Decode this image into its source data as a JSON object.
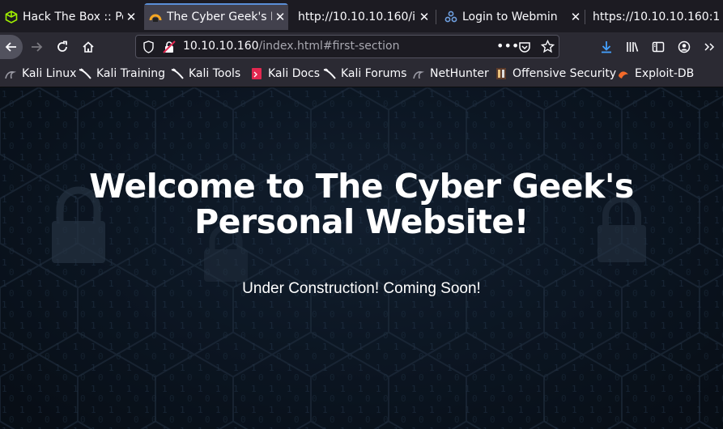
{
  "tabs": [
    {
      "label": "Hack The Box :: Po",
      "icon": "htb-cube-icon"
    },
    {
      "label": "The Cyber Geek's P",
      "icon": "cyber-geek-icon",
      "active": true
    },
    {
      "label": "http://10.10.10.160/in",
      "icon": ""
    },
    {
      "label": "Login to Webmin",
      "icon": "webmin-icon"
    },
    {
      "label": "https://10.10.10.160:1",
      "icon": ""
    }
  ],
  "urlbar": {
    "host": "10.10.10.160",
    "path": "/index.html#first-section"
  },
  "bookmarks": [
    {
      "label": "Kali Linux",
      "icon": "kali-dragon-icon"
    },
    {
      "label": "Kali Training",
      "icon": "kali-dragon-icon"
    },
    {
      "label": "Kali Tools",
      "icon": "kali-dragon-icon"
    },
    {
      "label": "Kali Docs",
      "icon": "kali-docs-icon"
    },
    {
      "label": "Kali Forums",
      "icon": "kali-dragon-icon"
    },
    {
      "label": "NetHunter",
      "icon": "nethunter-icon"
    },
    {
      "label": "Offensive Security",
      "icon": "offsec-icon"
    },
    {
      "label": "Exploit-DB",
      "icon": "exploitdb-icon"
    }
  ],
  "page": {
    "title": "Welcome to The Cyber Geek's Personal Website!",
    "subtitle": "Under Construction! Coming Soon!"
  },
  "colors": {
    "tab_accent": "#5a8fd8",
    "page_background": "#0b1522"
  }
}
